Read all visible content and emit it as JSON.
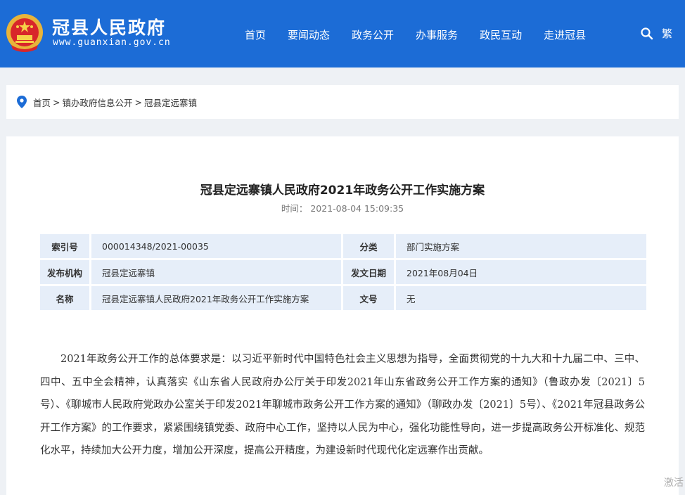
{
  "header": {
    "site_name": "冠县人民政府",
    "site_url": "www.guanxian.gov.cn",
    "nav": [
      "首页",
      "要闻动态",
      "政务公开",
      "办事服务",
      "政民互动",
      "走进冠县"
    ],
    "lang_toggle": "繁",
    "bg_color": "#1c6cd6"
  },
  "breadcrumb": {
    "items": [
      "首页",
      "镇办政府信息公开",
      "冠县定远寨镇"
    ],
    "separator": ">"
  },
  "article": {
    "title": "冠县定远寨镇人民政府2021年政务公开工作实施方案",
    "time_label": "时间：",
    "time_value": "2021-08-04 15:09:35",
    "meta": {
      "index_label": "索引号",
      "index_value": "000014348/2021-00035",
      "category_label": "分类",
      "category_value": "部门实施方案",
      "publisher_label": "发布机构",
      "publisher_value": "冠县定远寨镇",
      "date_label": "发文日期",
      "date_value": "2021年08月04日",
      "name_label": "名称",
      "name_value": "冠县定远寨镇人民政府2021年政务公开工作实施方案",
      "docno_label": "文号",
      "docno_value": "无"
    },
    "body": "2021年政务公开工作的总体要求是：以习近平新时代中国特色社会主义思想为指导，全面贯彻党的十九大和十九届二中、三中、四中、五中全会精神，认真落实《山东省人民政府办公厅关于印发2021年山东省政务公开工作方案的通知》（鲁政办发〔2021〕5号）、《聊城市人民政府党政办公室关于印发2021年聊城市政务公开工作方案的通知》（聊政办发〔2021〕5号）、《2021年冠县政务公开工作方案》的工作要求，紧紧围绕镇党委、政府中心工作，坚持以人民为中心，强化功能性导向，进一步提高政务公开标准化、规范化水平，持续加大公开力度，增加公开深度，提高公开精度，为建设新时代现代化定远寨作出贡献。"
  },
  "watermark": "激活"
}
